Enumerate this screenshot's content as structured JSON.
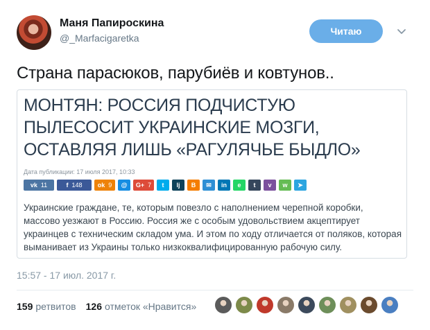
{
  "author": {
    "display_name": "Маня Папироскина",
    "handle": "@_Marfacigaretka"
  },
  "follow_button": "Читаю",
  "tweet_text": "Страна парасюков, парубиёв и ковтунов..",
  "card": {
    "headline": "МОНТЯН: РОССИЯ ПОДЧИСТУЮ ПЫЛЕСОСИТ УКРАИНСКИЕ МОЗГИ, ОСТАВЛЯЯ ЛИШЬ «РАГУЛЯЧЬЕ БЫДЛО»",
    "pub_date": "Дата публикации: 17 июля 2017, 10:33",
    "share_buttons": [
      {
        "icon": "vk-icon",
        "label": "vk",
        "count": "11",
        "color": "#4c75a3",
        "w": 44
      },
      {
        "icon": "facebook-icon",
        "label": "f",
        "count": "148",
        "color": "#3b5998",
        "w": 50
      },
      {
        "icon": "odnoklassniki-icon",
        "label": "ok",
        "count": "9",
        "color": "#ee8208",
        "w": 30
      },
      {
        "icon": "moimir-icon",
        "label": "@",
        "count": "",
        "color": "#168de2",
        "w": 18
      },
      {
        "icon": "google-plus-icon",
        "label": "G+",
        "count": "7",
        "color": "#dd4b39",
        "w": 30
      },
      {
        "icon": "twitter-icon",
        "label": "t",
        "count": "",
        "color": "#00aced",
        "w": 18
      },
      {
        "icon": "livejournal-icon",
        "label": "lj",
        "count": "",
        "color": "#0d425a",
        "w": 18
      },
      {
        "icon": "blogger-icon",
        "label": "B",
        "count": "",
        "color": "#f57d00",
        "w": 18
      },
      {
        "icon": "mail-icon",
        "label": "✉",
        "count": "",
        "color": "#2e8fd5",
        "w": 18
      },
      {
        "icon": "linkedin-icon",
        "label": "in",
        "count": "",
        "color": "#0077b5",
        "w": 18
      },
      {
        "icon": "evernote-icon",
        "label": "e",
        "count": "",
        "color": "#24d666",
        "w": 18
      },
      {
        "icon": "tumblr-icon",
        "label": "t",
        "count": "",
        "color": "#35465c",
        "w": 18
      },
      {
        "icon": "viber-icon",
        "label": "v",
        "count": "",
        "color": "#7b519d",
        "w": 18
      },
      {
        "icon": "whatsapp-icon",
        "label": "w",
        "count": "",
        "color": "#65bc54",
        "w": 18
      },
      {
        "icon": "telegram-icon",
        "label": "➤",
        "count": "",
        "color": "#2ca5e0",
        "w": 18
      }
    ],
    "excerpt": "Украинские граждане, те, которым повезло с наполнением черепной коробки, массово уезжают в Россию. Россия же с особым удовольствием акцептирует украинцев с техническим складом ума. И этом по ходу отличается от поляков, которая выманивает из Украины только низкоквалифицированную рабочую силу."
  },
  "timestamp": "15:57 - 17 июл. 2017 г.",
  "stats": {
    "retweets_count": "159",
    "retweets_label": "ретвитов",
    "likes_count": "126",
    "likes_label": "отметок «Нравится»"
  },
  "likers": [
    {
      "icon": "liker-avatar",
      "color": "#5b5b5b"
    },
    {
      "icon": "liker-avatar",
      "color": "#7d8a4a"
    },
    {
      "icon": "liker-avatar",
      "color": "#c0392b"
    },
    {
      "icon": "liker-avatar",
      "color": "#8a7a68"
    },
    {
      "icon": "liker-avatar",
      "color": "#3c4a5c"
    },
    {
      "icon": "liker-avatar",
      "color": "#6e8f5a"
    },
    {
      "icon": "liker-avatar",
      "color": "#a09060"
    },
    {
      "icon": "liker-avatar",
      "color": "#6b4b2e"
    },
    {
      "icon": "liker-avatar",
      "color": "#4a7fc1"
    }
  ]
}
